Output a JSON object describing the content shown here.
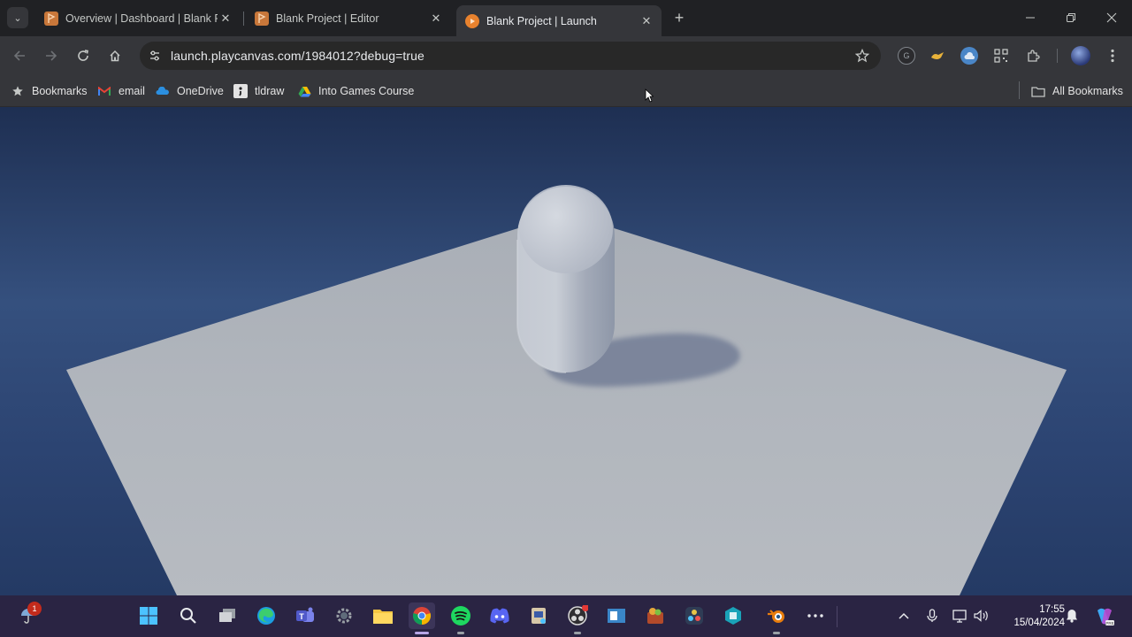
{
  "browser": {
    "tabs": [
      {
        "title": "Overview | Dashboard | Blank Pr",
        "favicon": "playcanvas-icon",
        "active": false
      },
      {
        "title": "Blank Project | Editor",
        "favicon": "playcanvas-icon",
        "active": false
      },
      {
        "title": "Blank Project | Launch",
        "favicon": "playcanvas-launch-icon",
        "active": true
      }
    ],
    "omnibox": {
      "url": "launch.playcanvas.com/1984012?debug=true"
    },
    "bookmarks": [
      {
        "label": "Bookmarks",
        "icon": "star-icon"
      },
      {
        "label": "email",
        "icon": "gmail-icon"
      },
      {
        "label": "OneDrive",
        "icon": "onedrive-icon"
      },
      {
        "label": "tldraw",
        "icon": "tldraw-icon"
      },
      {
        "label": "Into Games Course",
        "icon": "google-drive-icon"
      }
    ],
    "all_bookmarks_label": "All Bookmarks"
  },
  "scene": {
    "description_colors": {
      "sky_top": "#1e2f52",
      "sky_mid": "#35507e",
      "ground": "#b4b9c0",
      "capsule": "#c4c9d1",
      "shadow": "#7a849a"
    }
  },
  "taskbar": {
    "weather_badge": "1",
    "apps": [
      "windows-start-icon",
      "search-icon",
      "task-view-icon",
      "edge-icon",
      "teams-icon",
      "settings-icon",
      "file-explorer-icon",
      "chrome-icon",
      "spotify-icon",
      "discord-icon",
      "snipping-tool-icon",
      "obs-icon",
      "blue-app-icon",
      "fruit-app-icon",
      "davinci-icon",
      "teal-app-icon",
      "blender-icon",
      "more-icon"
    ],
    "clock": {
      "time": "17:55",
      "date": "15/04/2024"
    }
  },
  "colors": {
    "chrome_dark": "#202124",
    "chrome_toolbar": "#35363a",
    "taskbar": "#2a2443",
    "playcanvas_orange": "#e8822e"
  }
}
